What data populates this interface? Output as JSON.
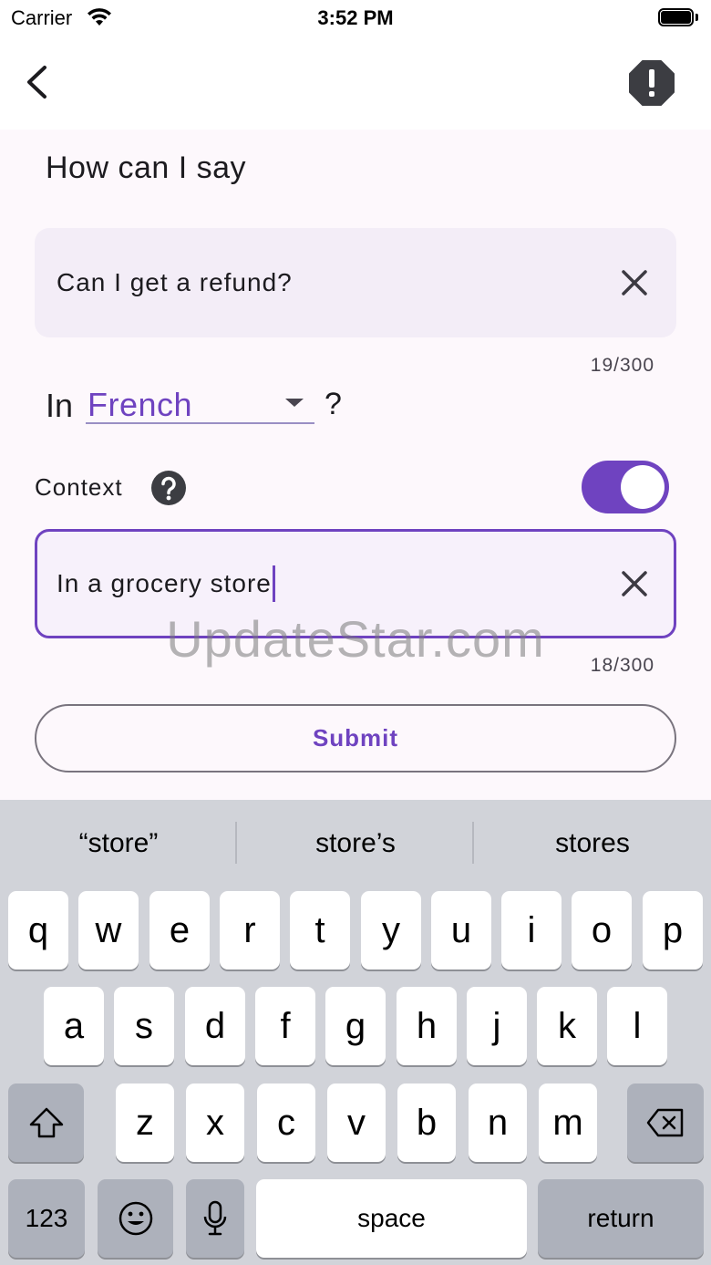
{
  "status_bar": {
    "carrier": "Carrier",
    "time": "3:52 PM"
  },
  "app_bar": {
    "back_icon": "chevron-left-icon",
    "report_icon": "octagon-exclamation-icon"
  },
  "section_title": "How can I say",
  "phrase_field": {
    "value": "Can I get a refund?",
    "counter": "19/300"
  },
  "language": {
    "prefix": "In",
    "selected": "French",
    "suffix": "?"
  },
  "context": {
    "label": "Context",
    "help_icon": "question-circle-icon",
    "enabled": true
  },
  "context_field": {
    "value": "In a grocery store",
    "counter": "18/300"
  },
  "watermark": "UpdateStar.com",
  "submit_label": "Submit",
  "keyboard": {
    "predictions": [
      "“store”",
      "store’s",
      "stores"
    ],
    "row1": [
      "q",
      "w",
      "e",
      "r",
      "t",
      "y",
      "u",
      "i",
      "o",
      "p"
    ],
    "row2": [
      "a",
      "s",
      "d",
      "f",
      "g",
      "h",
      "j",
      "k",
      "l"
    ],
    "row3": [
      "z",
      "x",
      "c",
      "v",
      "b",
      "n",
      "m"
    ],
    "numbers_label": "123",
    "space_label": "space",
    "return_label": "return"
  },
  "colors": {
    "accent": "#6f43c0",
    "field_bg": "#f3edf7",
    "keyboard_bg": "#d1d3d9",
    "function_key": "#adb1bb"
  }
}
